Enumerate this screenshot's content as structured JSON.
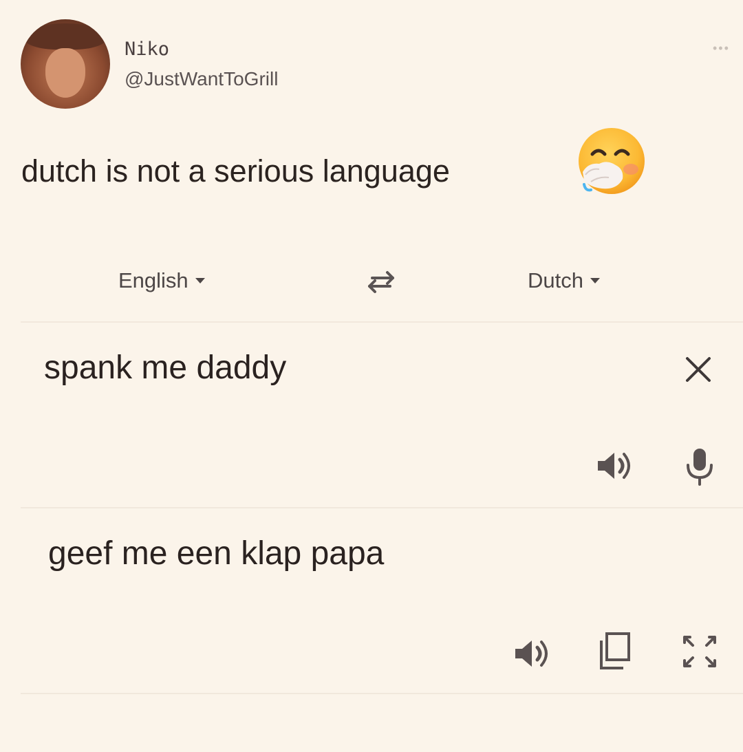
{
  "tweet": {
    "author_name": "Niko",
    "author_handle": "@JustWantToGrill",
    "text": "dutch is not a serious language",
    "emoji": "face-with-hand-over-mouth",
    "more_icon": "more-options-icon"
  },
  "translate": {
    "source_language": "English",
    "target_language": "Dutch",
    "source_text": "spank me daddy",
    "translated_text": "geef me een klap papa",
    "icons": {
      "swap": "swap-languages-icon",
      "clear": "close-icon",
      "listen_source": "speaker-icon",
      "voice_input": "mic-icon",
      "listen_translation": "speaker-icon",
      "copy": "copy-icon",
      "fullscreen": "expand-icon"
    }
  },
  "colors": {
    "background": "#fbf4ea",
    "text": "#2e2624",
    "muted_text": "#4c4646",
    "emoji_yellow": "#fcb934",
    "divider": "#f1e8dc"
  }
}
